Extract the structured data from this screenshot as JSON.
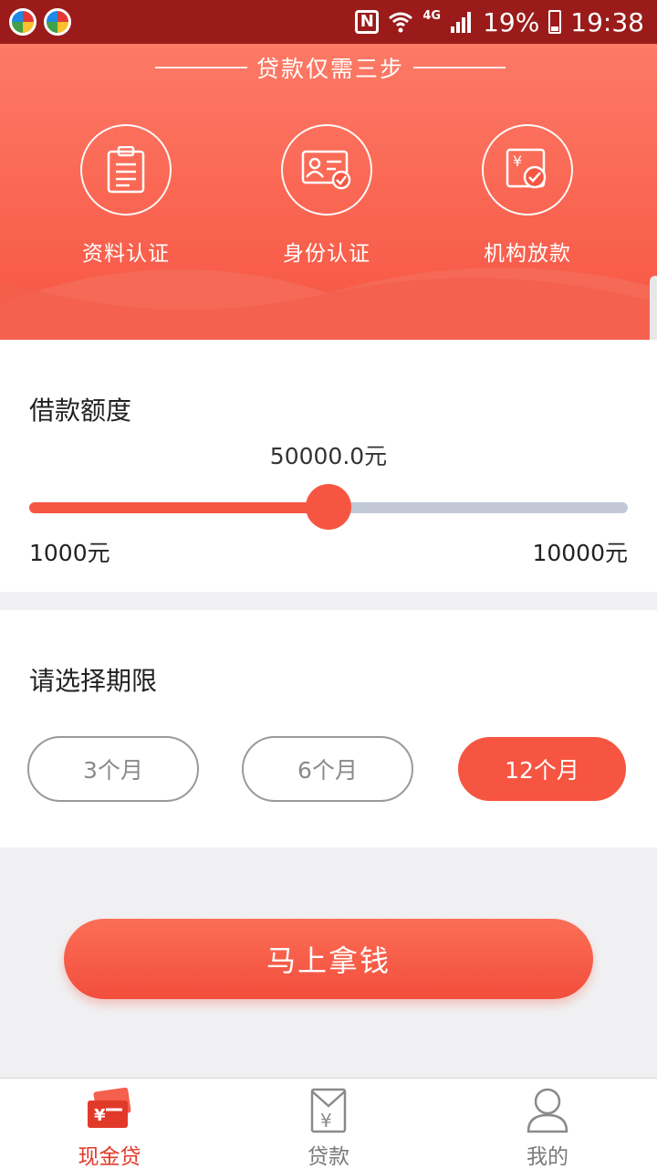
{
  "status_bar": {
    "battery": "19%",
    "time": "19:38",
    "network": "4G",
    "nfc": "N"
  },
  "hero": {
    "title": "贷款仅需三步",
    "steps": [
      {
        "label": "资料认证",
        "icon": "clipboard-icon"
      },
      {
        "label": "身份认证",
        "icon": "id-card-check-icon"
      },
      {
        "label": "机构放款",
        "icon": "yen-document-check-icon"
      }
    ]
  },
  "amount": {
    "title": "借款额度",
    "value": "50000.0元",
    "min_label": "1000元",
    "max_label": "10000元",
    "slider_fraction": 0.5
  },
  "term": {
    "title": "请选择期限",
    "options": [
      {
        "label": "3个月",
        "selected": false
      },
      {
        "label": "6个月",
        "selected": false
      },
      {
        "label": "12个月",
        "selected": true
      }
    ]
  },
  "cta": {
    "label": "马上拿钱"
  },
  "tabbar": {
    "items": [
      {
        "label": "现金贷",
        "icon": "cash-cards-icon",
        "active": true
      },
      {
        "label": "贷款",
        "icon": "yen-envelope-icon",
        "active": false
      },
      {
        "label": "我的",
        "icon": "user-icon",
        "active": false
      }
    ]
  },
  "colors": {
    "accent": "#f65542",
    "status_bar": "#9b1b1b",
    "track": "#c2c8d6",
    "active_tab": "#e23a2a"
  }
}
